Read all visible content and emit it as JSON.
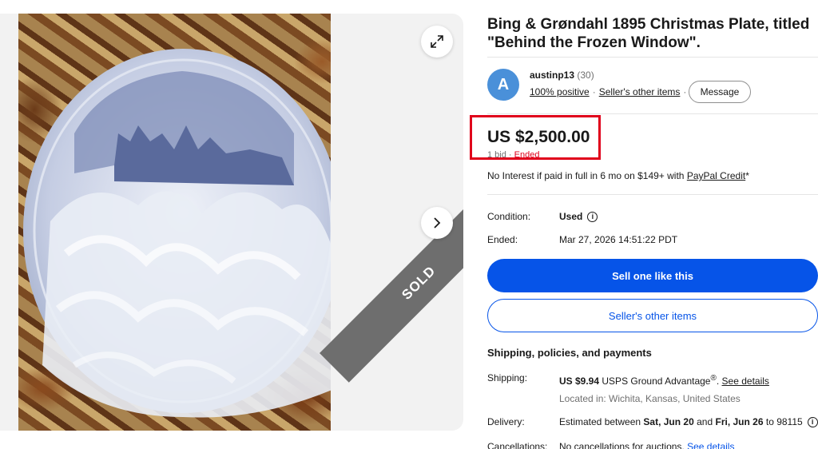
{
  "gallery": {
    "sold_label": "SOLD",
    "expand_icon": "expand-icon",
    "next_icon": "chevron-right-icon"
  },
  "listing": {
    "title": "Bing & Grøndahl 1895 Christmas Plate, titled \"Behind the Frozen Window\"."
  },
  "seller": {
    "avatar_letter": "A",
    "name": "austinp13",
    "score": "(30)",
    "positive": "100% positive",
    "other_items_link": "Seller's other items",
    "message_button": "Message"
  },
  "price": {
    "amount": "US $2,500.00",
    "bids": "1 bid",
    "separator": "·",
    "status": "Ended"
  },
  "financing": {
    "text": "No Interest if paid in full in 6 mo on $149+ with",
    "link": "PayPal Credit",
    "suffix": "*"
  },
  "details": {
    "condition_label": "Condition:",
    "condition_value": "Used",
    "ended_label": "Ended:",
    "ended_value": "Mar 27, 2026 14:51:22 PDT"
  },
  "actions": {
    "primary": "Sell one like this",
    "secondary": "Seller's other items"
  },
  "shipping": {
    "section_title": "Shipping, policies, and payments",
    "shipping_label": "Shipping:",
    "shipping_price": "US $9.94",
    "shipping_service": "USPS Ground Advantage",
    "shipping_mark": "®",
    "shipping_link": "See details",
    "located": "Located in: Wichita, Kansas, United States",
    "delivery_label": "Delivery:",
    "delivery_prefix": "Estimated between",
    "delivery_start": "Sat, Jun 20",
    "delivery_and": "and",
    "delivery_end": "Fri, Jun 26",
    "delivery_to": "to 98115",
    "cancellations_label": "Cancellations:",
    "cancellations_value": "No cancellations for auctions.",
    "cancellations_link": "See details"
  },
  "colors": {
    "accent_blue": "#0654e8",
    "ended_red": "#e0001b",
    "highlight_box": "#e0001b"
  }
}
